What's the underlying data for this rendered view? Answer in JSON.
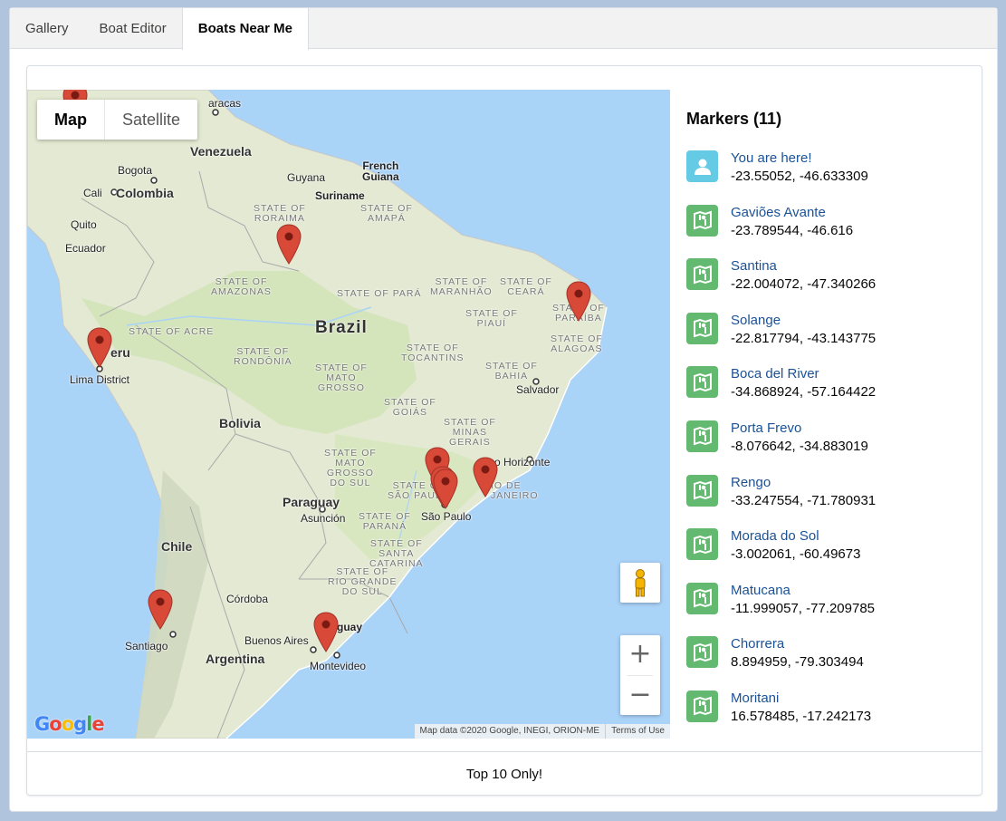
{
  "tabs": [
    {
      "label": "Gallery"
    },
    {
      "label": "Boat Editor"
    },
    {
      "label": "Boats Near Me"
    }
  ],
  "map": {
    "type_buttons": {
      "map": "Map",
      "satellite": "Satellite"
    },
    "zoom_in": "+",
    "zoom_out": "−",
    "logo": "Google",
    "attribution": "Map data ©2020 Google, INEGI, ORION-ME",
    "terms": "Terms of Use",
    "labels": {
      "venezuela": "Venezuela",
      "colombia": "Colombia",
      "bogota": "Bogota",
      "cali": "Cali",
      "quito": "Quito",
      "ecuador": "Ecuador",
      "caracas": "aracas",
      "guyana": "Guyana",
      "french_guiana": "French\nGuiana",
      "suriname": "Suriname",
      "peru": "eru",
      "lima": "Lima District",
      "brazil": "Brazil",
      "bolivia": "Bolivia",
      "paraguay": "Paraguay",
      "asuncion": "Asunción",
      "chile": "Chile",
      "santiago": "Santiago",
      "cordoba": "Córdoba",
      "buenos_aires": "Buenos Aires",
      "argentina": "Argentina",
      "montevideo": "Montevideo",
      "uruguay": "guay",
      "salvador": "Salvador",
      "sao_paulo": "São Paulo",
      "belo": "o Horizonte",
      "rio": "IO DE\nJANEIRO",
      "rio_partial": "",
      "s_roraima": "STATE OF\nRORAIMA",
      "s_amapa": "STATE OF\nAMAPÁ",
      "s_amazonas": "STATE OF\nAMAZONAS",
      "s_para": "STATE OF PARÁ",
      "s_maranhao": "STATE OF\nMARANHÃO",
      "s_ceara": "STATE OF\nCEARÁ",
      "s_piaui": "STATE OF\nPIAUÍ",
      "s_paraiba": "STATE OF\nPARAÍBA",
      "s_alagoas": "STATE OF\nALAGOAS",
      "s_acre": "STATE OF ACRE",
      "s_rondonia": "STATE OF\nRONDÔNIA",
      "s_tocantins": "STATE OF\nTOCANTINS",
      "s_bahia": "STATE OF\nBAHIA",
      "s_mato_grosso": "STATE OF\nMATO\nGROSSO",
      "s_goias": "STATE OF\nGOIÁS",
      "s_minas": "STATE OF\nMINAS\nGERAIS",
      "s_mgs": "STATE OF\nMATO\nGROSSO\nDO SUL",
      "s_sp": "STATE OF\nSÃO PAULO",
      "s_parana": "STATE OF\nPARANÁ",
      "s_sc": "STATE OF\nSANTA\nCATARINA",
      "s_rs": "STATE OF\nRIO GRANDE\nDO SUL"
    }
  },
  "panel": {
    "title": "Markers (11)",
    "markers": [
      {
        "title": "You are here!",
        "coords": "-23.55052, -46.633309",
        "icon": "user-icon"
      },
      {
        "title": "Gaviões Avante",
        "coords": "-23.789544, -46.616",
        "icon": "location-icon"
      },
      {
        "title": "Santina",
        "coords": "-22.004072, -47.340266",
        "icon": "location-icon"
      },
      {
        "title": "Solange",
        "coords": "-22.817794, -43.143775",
        "icon": "location-icon"
      },
      {
        "title": "Boca del River",
        "coords": "-34.868924, -57.164422",
        "icon": "location-icon"
      },
      {
        "title": "Porta Frevo",
        "coords": "-8.076642, -34.883019",
        "icon": "location-icon"
      },
      {
        "title": "Rengo",
        "coords": "-33.247554, -71.780931",
        "icon": "location-icon"
      },
      {
        "title": "Morada do Sol",
        "coords": "-3.002061, -60.49673",
        "icon": "location-icon"
      },
      {
        "title": "Matucana",
        "coords": "-11.999057, -77.209785",
        "icon": "location-icon"
      },
      {
        "title": "Chorrera",
        "coords": "8.894959, -79.303494",
        "icon": "location-icon"
      },
      {
        "title": "Moritani",
        "coords": "16.578485, -17.242173",
        "icon": "location-icon"
      }
    ]
  },
  "footer": {
    "label": "Top 10 Only!"
  },
  "colors": {
    "link": "#1b5297",
    "user_avatar": "#65cae4",
    "location_avatar": "#62b96f",
    "pin": "#d84a37",
    "land": "#e8ecd9",
    "water": "#aad3f8"
  }
}
